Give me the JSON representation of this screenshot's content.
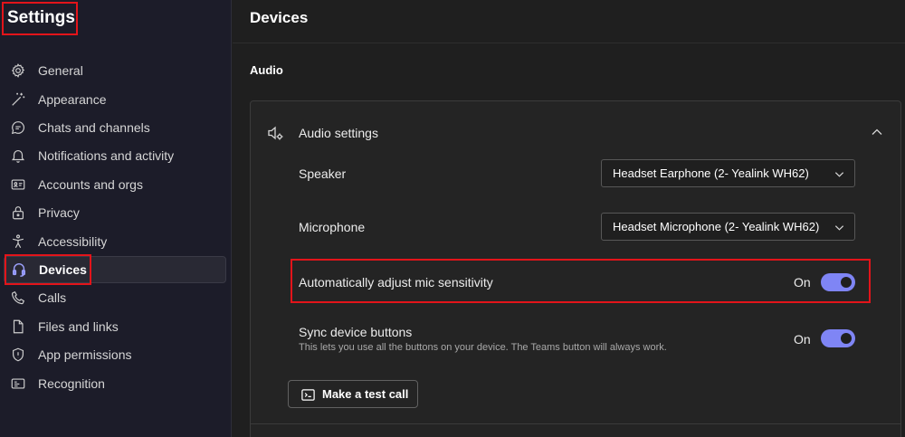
{
  "sidebar": {
    "title": "Settings",
    "items": [
      {
        "label": "General",
        "icon": "gear-icon"
      },
      {
        "label": "Appearance",
        "icon": "wand-icon"
      },
      {
        "label": "Chats and channels",
        "icon": "chat-icon"
      },
      {
        "label": "Notifications and activity",
        "icon": "bell-icon"
      },
      {
        "label": "Accounts and orgs",
        "icon": "id-card-icon"
      },
      {
        "label": "Privacy",
        "icon": "lock-icon"
      },
      {
        "label": "Accessibility",
        "icon": "accessibility-icon"
      },
      {
        "label": "Devices",
        "icon": "headset-icon",
        "active": true
      },
      {
        "label": "Calls",
        "icon": "phone-icon"
      },
      {
        "label": "Files and links",
        "icon": "file-icon"
      },
      {
        "label": "App permissions",
        "icon": "shield-icon"
      },
      {
        "label": "Recognition",
        "icon": "recognition-icon"
      }
    ]
  },
  "main": {
    "title": "Devices",
    "section": "Audio",
    "card": {
      "header": "Audio settings",
      "speaker": {
        "label": "Speaker",
        "value": "Headset Earphone (2- Yealink WH62)"
      },
      "microphone": {
        "label": "Microphone",
        "value": "Headset Microphone (2- Yealink WH62)"
      },
      "auto_mic": {
        "label": "Automatically adjust mic sensitivity",
        "state": "On"
      },
      "sync_buttons": {
        "label": "Sync device buttons",
        "description": "This lets you use all the buttons on your device. The Teams button will always work.",
        "state": "On"
      },
      "test_call": "Make a test call"
    }
  },
  "colors": {
    "accent": "#7f85f5",
    "highlight_box": "#e3141a",
    "sidebar_bg": "#1c1c29",
    "main_bg": "#1f1f1f"
  }
}
